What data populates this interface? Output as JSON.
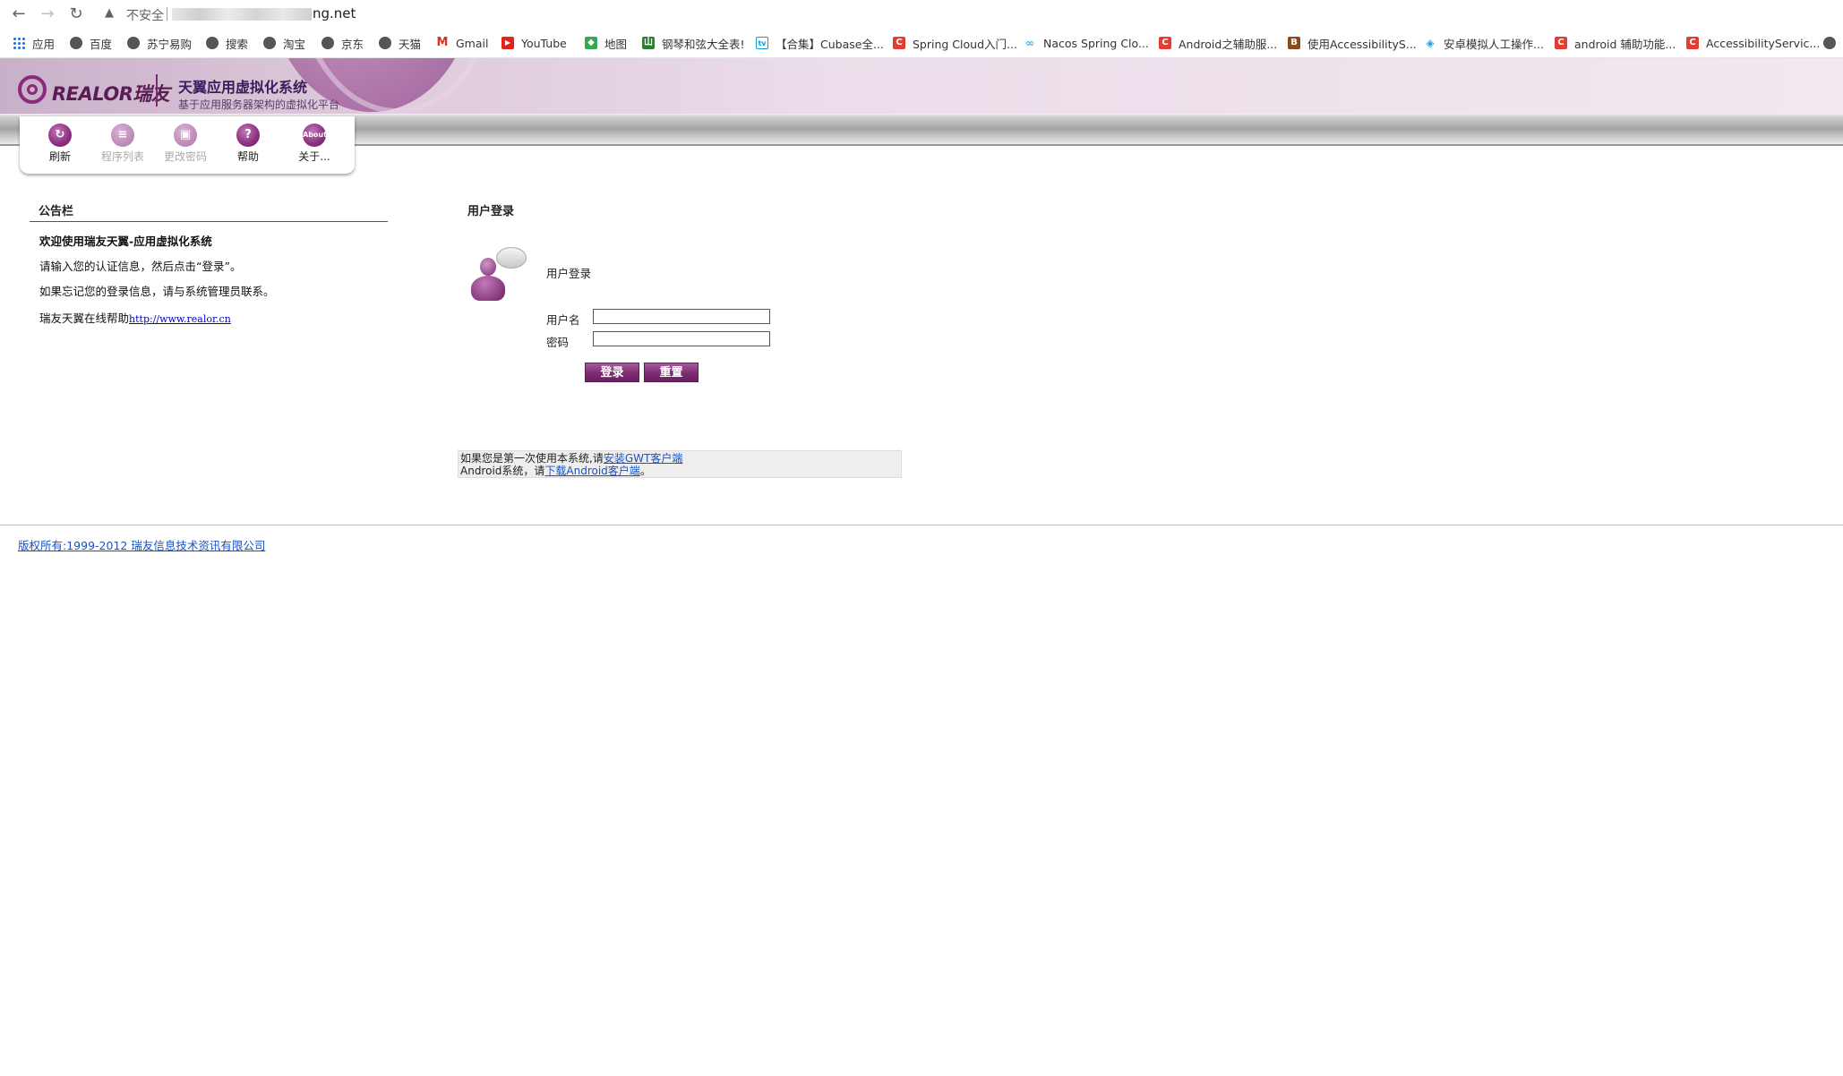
{
  "browser": {
    "back_icon": "←",
    "forward_icon": "→",
    "reload_icon": "↻",
    "insecure_icon": "▲",
    "insecure_label": "不安全",
    "url_visible": "ng.net",
    "bookmarks": [
      {
        "label": "应用",
        "icon": "apps-grid-icon"
      },
      {
        "label": "百度",
        "icon": "globe-icon"
      },
      {
        "label": "苏宁易购",
        "icon": "globe-icon"
      },
      {
        "label": "搜索",
        "icon": "globe-icon"
      },
      {
        "label": "淘宝",
        "icon": "globe-icon"
      },
      {
        "label": "京东",
        "icon": "globe-icon"
      },
      {
        "label": "天猫",
        "icon": "globe-icon"
      },
      {
        "label": "Gmail",
        "icon": "gmail-icon"
      },
      {
        "label": "YouTube",
        "icon": "youtube-icon"
      },
      {
        "label": "地图",
        "icon": "maps-icon"
      },
      {
        "label": "钢琴和弦大全表!",
        "icon": "site-icon"
      },
      {
        "label": "【合集】Cubase全...",
        "icon": "bilibili-icon"
      },
      {
        "label": "Spring Cloud入门...",
        "icon": "csdn-icon"
      },
      {
        "label": "Nacos Spring Clo...",
        "icon": "nacos-icon"
      },
      {
        "label": "Android之辅助服...",
        "icon": "csdn-icon"
      },
      {
        "label": "使用AccessibilityS...",
        "icon": "jb-icon"
      },
      {
        "label": "安卓模拟人工操作...",
        "icon": "diamond-icon"
      },
      {
        "label": "android 辅助功能...",
        "icon": "csdn-icon"
      },
      {
        "label": "AccessibilityServic...",
        "icon": "csdn-icon"
      }
    ]
  },
  "header": {
    "logo_text": "REALOR瑞友",
    "title": "天翼应用虚拟化系统",
    "subtitle": "基于应用服务器架构的虚拟化平台"
  },
  "toolbar": {
    "items": [
      {
        "label": "刷新",
        "glyph": "↻",
        "enabled": true
      },
      {
        "label": "程序列表",
        "glyph": "≡",
        "enabled": false
      },
      {
        "label": "更改密码",
        "glyph": "▣",
        "enabled": false
      },
      {
        "label": "帮助",
        "glyph": "?",
        "enabled": true
      },
      {
        "label": "关于...",
        "glyph": "About",
        "enabled": true
      }
    ]
  },
  "notice": {
    "title": "公告栏",
    "welcome": "欢迎使用瑞友天翼-应用虚拟化系统",
    "line1": "请输入您的认证信息，然后点击“登录”。",
    "line2": "如果忘记您的登录信息，请与系统管理员联系。",
    "help_prefix": "瑞友天翼在线帮助",
    "help_link": "http://www.realor.cn"
  },
  "login": {
    "heading": "用户登录",
    "subheading": "用户登录",
    "username_label": "用户名",
    "username_value": "",
    "password_label": "密码",
    "password_value": "",
    "login_button": "登录",
    "reset_button": "重置"
  },
  "info": {
    "line1_prefix": "如果您是第一次使用本系统,请",
    "line1_link": "安装GWT客户端",
    "line2_prefix": "Android系统，请",
    "line2_link": "下载Android客户端",
    "line2_suffix": "。"
  },
  "footer": {
    "copyright": "版权所有:1999-2012 瑞友信息技术资讯有限公司"
  },
  "colors": {
    "brand_purple": "#7c2c73",
    "link_blue": "#1a52c4"
  }
}
